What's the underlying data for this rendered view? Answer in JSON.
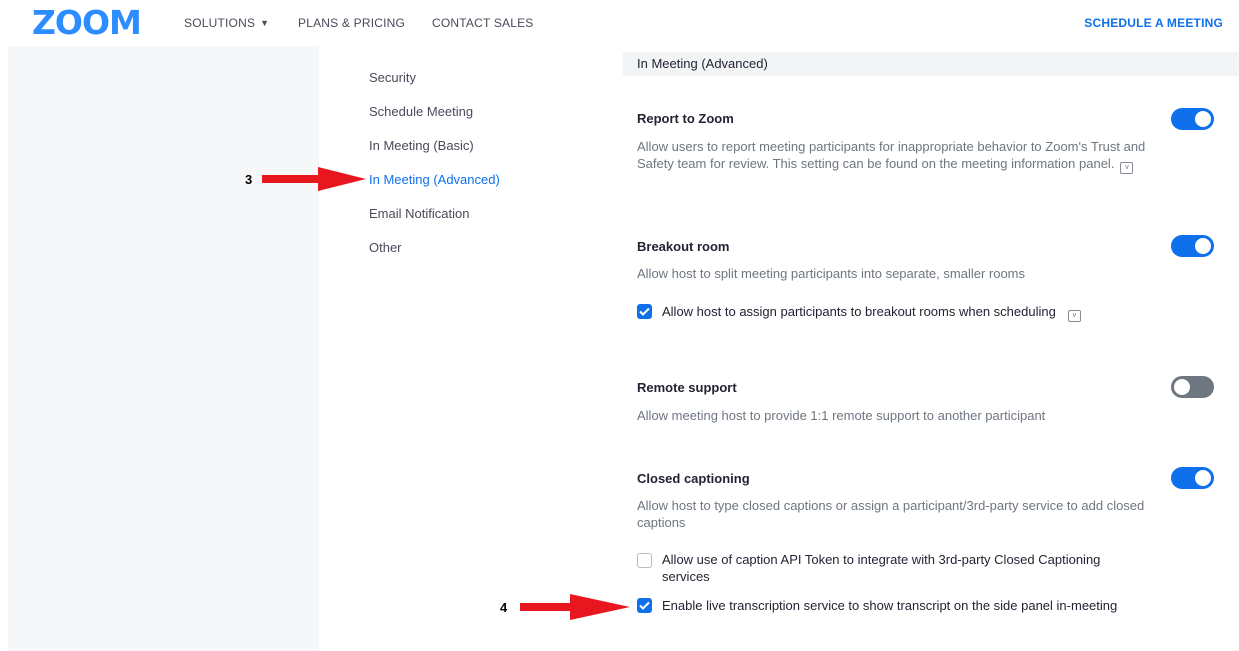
{
  "header": {
    "logo": "ZOOM",
    "nav": {
      "solutions": "SOLUTIONS",
      "plans": "PLANS & PRICING",
      "contact": "CONTACT SALES",
      "schedule": "SCHEDULE A MEETING"
    }
  },
  "sidebar": {
    "items": [
      {
        "label": "Security"
      },
      {
        "label": "Schedule Meeting"
      },
      {
        "label": "In Meeting (Basic)"
      },
      {
        "label": "In Meeting (Advanced)"
      },
      {
        "label": "Email Notification"
      },
      {
        "label": "Other"
      }
    ],
    "active_index": 3
  },
  "section": {
    "title": "In Meeting (Advanced)"
  },
  "settings": [
    {
      "title": "Report to Zoom",
      "description": "Allow users to report meeting participants for inappropriate behavior to Zoom's Trust and Safety team for review. This setting can be found on the meeting information panel.",
      "info_icon": "v",
      "enabled": true
    },
    {
      "title": "Breakout room",
      "description": "Allow host to split meeting participants into separate, smaller rooms",
      "enabled": true,
      "options": [
        {
          "label": "Allow host to assign participants to breakout rooms when scheduling",
          "checked": true,
          "info_icon": "v"
        }
      ]
    },
    {
      "title": "Remote support",
      "description": "Allow meeting host to provide 1:1 remote support to another participant",
      "enabled": false
    },
    {
      "title": "Closed captioning",
      "description": "Allow host to type closed captions or assign a participant/3rd-party service to add closed captions",
      "enabled": true,
      "options": [
        {
          "label": "Allow use of caption API Token to integrate with 3rd-party Closed Captioning services",
          "checked": false
        },
        {
          "label": "Enable live transcription service to show transcript on the side panel in-meeting",
          "checked": true
        }
      ]
    }
  ],
  "annotations": {
    "step3": "3",
    "step4": "4",
    "arrow_color": "#E8161E"
  },
  "colors": {
    "brand": "#2D8CFF",
    "accent": "#0E71EB",
    "toggle_off": "#6E7680"
  }
}
